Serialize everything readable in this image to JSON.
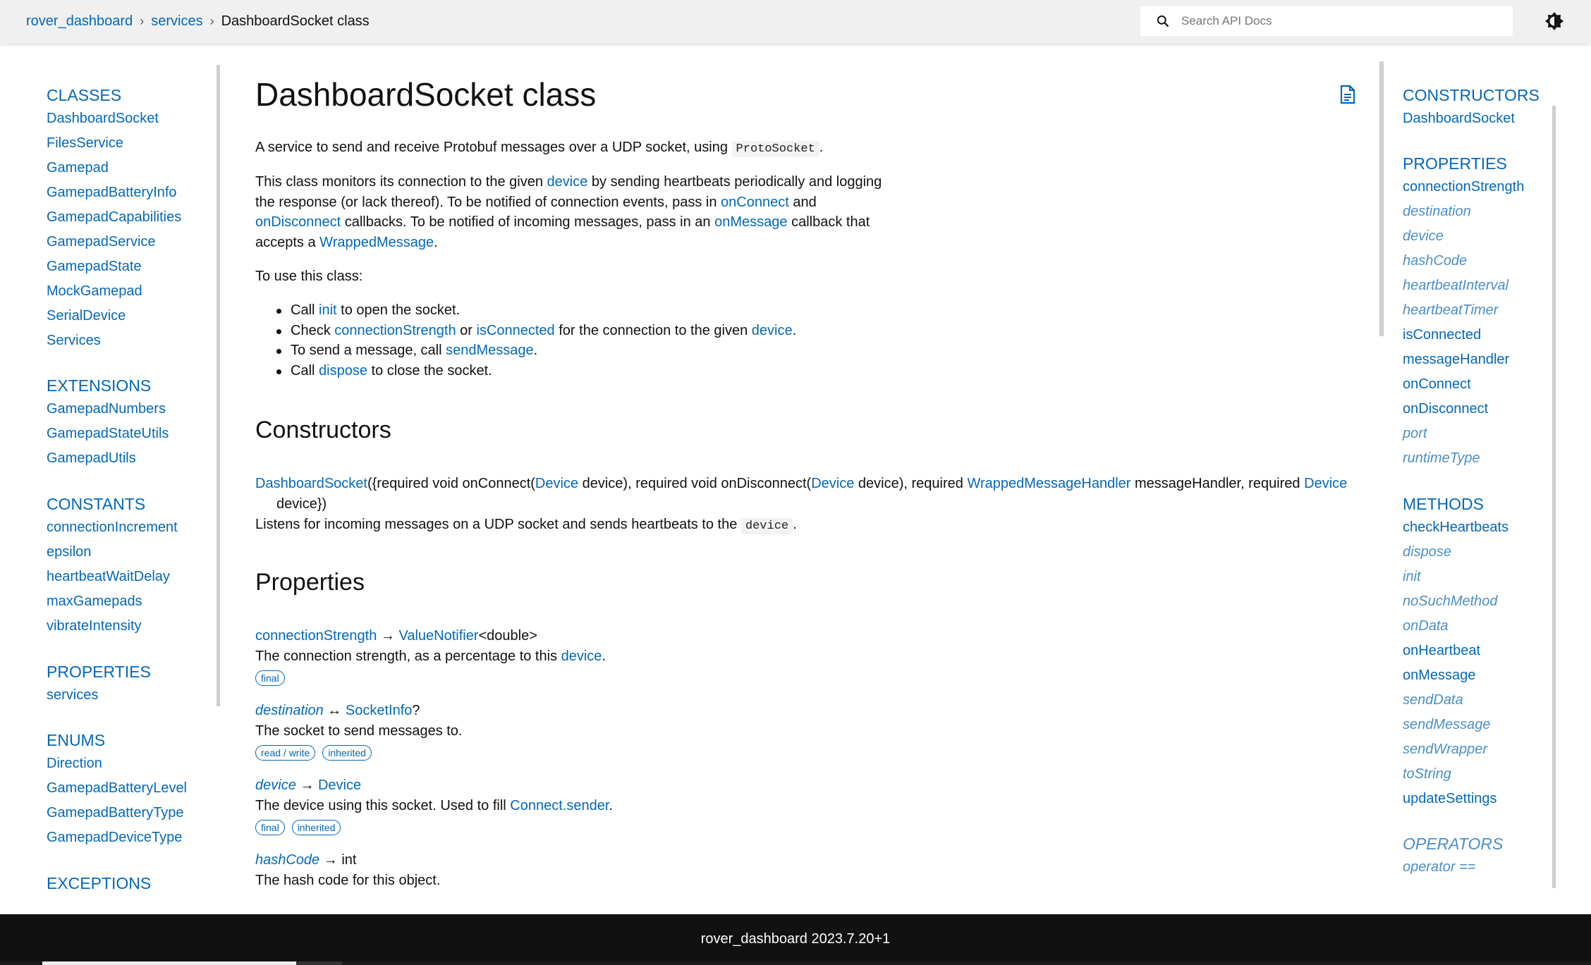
{
  "breadcrumb": {
    "items": [
      "rover_dashboard",
      "services"
    ],
    "current": "DashboardSocket class"
  },
  "search": {
    "placeholder": "Search API Docs"
  },
  "left_sidebar": {
    "sections": [
      {
        "title": "CLASSES",
        "items": [
          "DashboardSocket",
          "FilesService",
          "Gamepad",
          "GamepadBatteryInfo",
          "GamepadCapabilities",
          "GamepadService",
          "GamepadState",
          "MockGamepad",
          "SerialDevice",
          "Services"
        ]
      },
      {
        "title": "EXTENSIONS",
        "items": [
          "GamepadNumbers",
          "GamepadStateUtils",
          "GamepadUtils"
        ]
      },
      {
        "title": "CONSTANTS",
        "items": [
          "connectionIncrement",
          "epsilon",
          "heartbeatWaitDelay",
          "maxGamepads",
          "vibrateIntensity"
        ]
      },
      {
        "title": "PROPERTIES",
        "items": [
          "services"
        ]
      },
      {
        "title": "ENUMS",
        "items": [
          "Direction",
          "GamepadBatteryLevel",
          "GamepadBatteryType",
          "GamepadDeviceType"
        ]
      },
      {
        "title": "EXCEPTIONS",
        "items": []
      }
    ]
  },
  "right_sidebar": {
    "sections": [
      {
        "title": "CONSTRUCTORS",
        "items": [
          {
            "label": "DashboardSocket",
            "inherited": false
          }
        ]
      },
      {
        "title": "PROPERTIES",
        "items": [
          {
            "label": "connectionStrength",
            "inherited": false
          },
          {
            "label": "destination",
            "inherited": true
          },
          {
            "label": "device",
            "inherited": true
          },
          {
            "label": "hashCode",
            "inherited": true
          },
          {
            "label": "heartbeatInterval",
            "inherited": true
          },
          {
            "label": "heartbeatTimer",
            "inherited": true
          },
          {
            "label": "isConnected",
            "inherited": false
          },
          {
            "label": "messageHandler",
            "inherited": false
          },
          {
            "label": "onConnect",
            "inherited": false
          },
          {
            "label": "onDisconnect",
            "inherited": false
          },
          {
            "label": "port",
            "inherited": true
          },
          {
            "label": "runtimeType",
            "inherited": true
          }
        ]
      },
      {
        "title": "METHODS",
        "items": [
          {
            "label": "checkHeartbeats",
            "inherited": false
          },
          {
            "label": "dispose",
            "inherited": true
          },
          {
            "label": "init",
            "inherited": true
          },
          {
            "label": "noSuchMethod",
            "inherited": true
          },
          {
            "label": "onData",
            "inherited": true
          },
          {
            "label": "onHeartbeat",
            "inherited": false
          },
          {
            "label": "onMessage",
            "inherited": false
          },
          {
            "label": "sendData",
            "inherited": true
          },
          {
            "label": "sendMessage",
            "inherited": true
          },
          {
            "label": "sendWrapper",
            "inherited": true
          },
          {
            "label": "toString",
            "inherited": true
          },
          {
            "label": "updateSettings",
            "inherited": false
          }
        ]
      },
      {
        "title": "OPERATORS",
        "items": [
          {
            "label": "operator ==",
            "inherited": true
          }
        ]
      }
    ]
  },
  "main": {
    "title": "DashboardSocket class",
    "intro": {
      "text_before": "A service to send and receive Protobuf messages over a UDP socket, using ",
      "code": "ProtoSocket",
      "text_after": "."
    },
    "para2": {
      "t1": "This class monitors its connection to the given ",
      "l1": "device",
      "t2": " by sending heartbeats periodically and logging the response (or lack thereof). To be notified of connection events, pass in ",
      "l2": "onConnect",
      "t3": " and ",
      "l3": "onDisconnect",
      "t4": " callbacks. To be notified of incoming messages, pass in an ",
      "l4": "onMessage",
      "t5": " callback that accepts a ",
      "l5": "WrappedMessage",
      "t6": "."
    },
    "usage_intro": "To use this class:",
    "usage": {
      "b1": {
        "t1": "Call ",
        "l1": "init",
        "t2": " to open the socket."
      },
      "b2": {
        "t1": "Check ",
        "l1": "connectionStrength",
        "t2": " or ",
        "l2": "isConnected",
        "t3": " for the connection to the given ",
        "l3": "device",
        "t4": "."
      },
      "b3": {
        "t1": "To send a message, call ",
        "l1": "sendMessage",
        "t2": "."
      },
      "b4": {
        "t1": "Call ",
        "l1": "dispose",
        "t2": " to close the socket."
      }
    },
    "constructors_heading": "Constructors",
    "constructor": {
      "name": "DashboardSocket",
      "s1": "({required void onConnect(",
      "t1": "Device",
      "s2": " device), required void onDisconnect(",
      "t2": "Device",
      "s3": " device), required ",
      "t3": "WrappedMessageHandler",
      "s4": " messageHandler, required ",
      "t4": "Device",
      "s5": "device})",
      "desc_before": "Listens for incoming messages on a UDP socket and sends heartbeats to the ",
      "desc_code": "device",
      "desc_after": "."
    },
    "properties_heading": "Properties",
    "properties": {
      "p1": {
        "name": "connectionStrength",
        "arrow": " → ",
        "type": "ValueNotifier",
        "type_suffix": "<double>",
        "desc_before": "The connection strength, as a percentage to this ",
        "desc_link": "device",
        "desc_after": ".",
        "badge1": "final"
      },
      "p2": {
        "name": "destination",
        "arrow": " ↔ ",
        "type": "SocketInfo",
        "type_suffix": "?",
        "desc": "The socket to send messages to.",
        "badge1": "read / write",
        "badge2": "inherited"
      },
      "p3": {
        "name": "device",
        "arrow": " → ",
        "type": "Device",
        "desc_before": "The device using this socket. Used to fill ",
        "desc_link": "Connect.sender",
        "desc_after": ".",
        "badge1": "final",
        "badge2": "inherited"
      },
      "p4": {
        "name": "hashCode",
        "arrow": " → ",
        "type": "int",
        "desc": "The hash code for this object."
      }
    }
  },
  "footer": {
    "text": "rover_dashboard 2023.7.20+1"
  },
  "colors": {
    "link": "#0468b8",
    "inherited_link": "#4b8fc7",
    "topbar_bg": "#f0f0f0",
    "footer_bg": "#111111"
  }
}
